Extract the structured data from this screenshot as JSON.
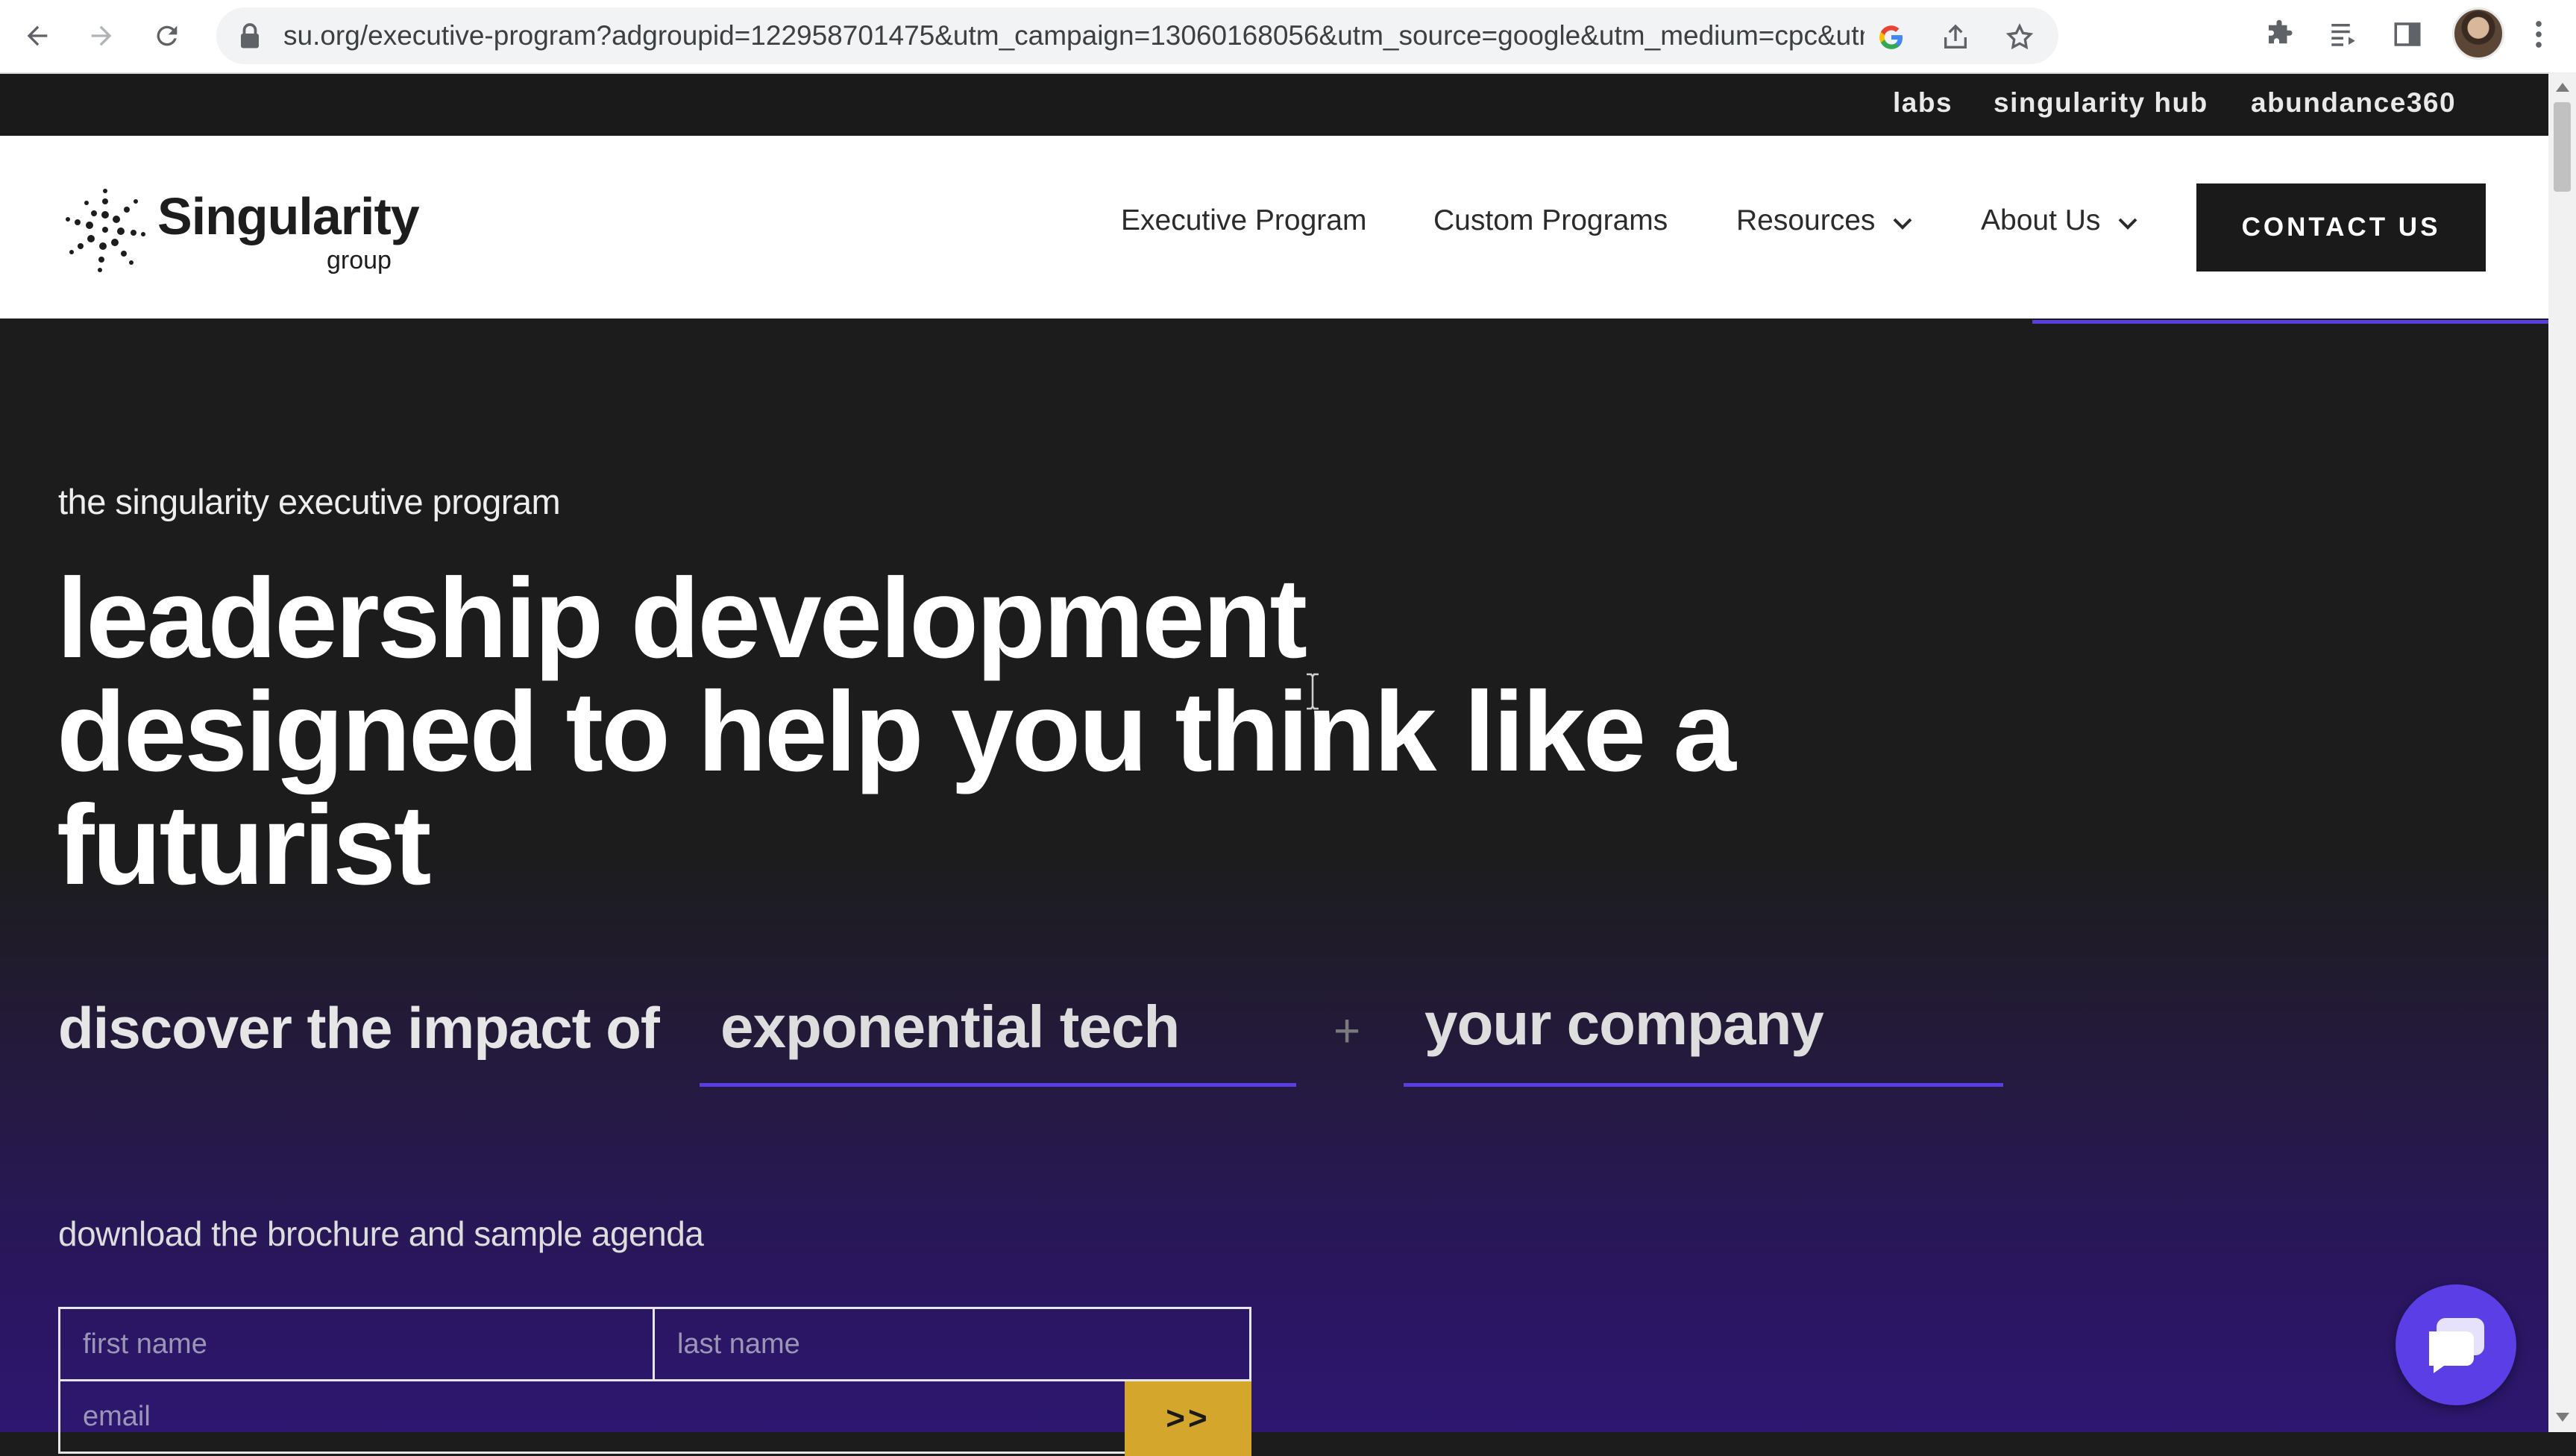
{
  "browser": {
    "url": "su.org/executive-program?adgroupid=122958701475&utm_campaign=13060168056&utm_source=google&utm_medium=cpc&utm_cont...",
    "icons": [
      "back-icon",
      "forward-icon",
      "reload-icon",
      "lock-icon",
      "google-icon",
      "share-icon",
      "bookmark-star-icon",
      "extensions-icon",
      "reading-list-icon",
      "side-panel-icon",
      "profile-avatar",
      "menu-kebab-icon"
    ]
  },
  "topbar": {
    "links": [
      "labs",
      "singularity hub",
      "abundance360"
    ]
  },
  "header": {
    "logo_word": "Singularity",
    "logo_sub": "group",
    "nav": [
      "Executive Program",
      "Custom Programs",
      "Resources",
      "About Us"
    ],
    "contact_label": "CONTACT US"
  },
  "hero": {
    "eyebrow": "the singularity executive program",
    "headline_1": "leadership development",
    "headline_2": "designed to help you think like a",
    "headline_3": "futurist",
    "discover_label": "discover the impact of",
    "slot_1": "exponential tech",
    "plus": "+",
    "slot_2": "your company",
    "download_label": "download the brochure and sample agenda"
  },
  "form": {
    "first_name_placeholder": "first name",
    "last_name_placeholder": "last name",
    "email_placeholder": "email",
    "submit_label": ">>"
  },
  "colors": {
    "accent": "#5a3fe0",
    "submit": "#d4a72c",
    "dark": "#1a1a1a",
    "chat": "#5b3ee6"
  }
}
